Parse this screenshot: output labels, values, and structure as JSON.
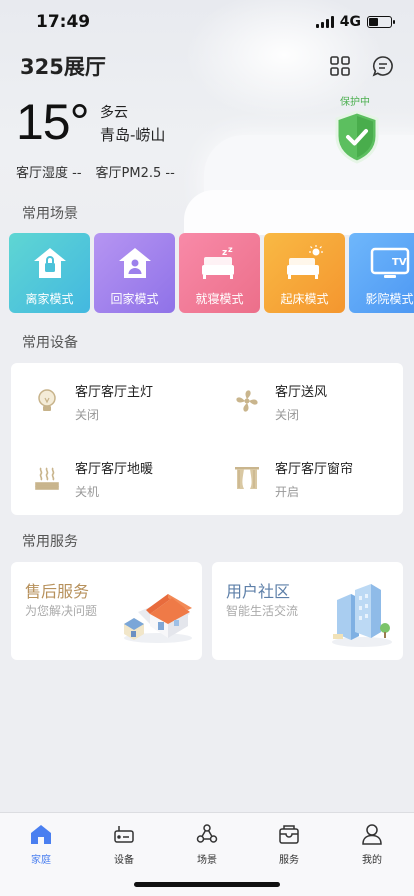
{
  "status_bar": {
    "time": "17:49",
    "network": "4G",
    "battery_level": 0.45
  },
  "header": {
    "home_name": "325展厅",
    "icons": [
      "grid-icon",
      "message-icon"
    ]
  },
  "weather": {
    "temperature": "15°",
    "condition": "多云",
    "location": "青岛-崂山",
    "humidity": "客厅湿度 --",
    "pm25": "客厅PM2.5 --"
  },
  "security": {
    "status": "保护中",
    "color": "#4caf50"
  },
  "scenes": {
    "title": "常用场景",
    "items": [
      {
        "label": "离家模式",
        "icon": "house-lock-icon",
        "color": "#43b8e0"
      },
      {
        "label": "回家模式",
        "icon": "house-person-icon",
        "color": "#8f72e8"
      },
      {
        "label": "就寝模式",
        "icon": "bed-sleep-icon",
        "color": "#ec6f8a"
      },
      {
        "label": "起床模式",
        "icon": "bed-sun-icon",
        "color": "#f4962f"
      },
      {
        "label": "影院模式",
        "icon": "tv-icon",
        "color": "#4a95f2"
      }
    ]
  },
  "devices": {
    "title": "常用设备",
    "items": [
      {
        "name": "客厅客厅主灯",
        "state": "关闭",
        "icon": "bulb-icon"
      },
      {
        "name": "客厅送风",
        "state": "关闭",
        "icon": "fan-icon"
      },
      {
        "name": "客厅客厅地暖",
        "state": "关机",
        "icon": "floor-heating-icon"
      },
      {
        "name": "客厅客厅窗帘",
        "state": "开启",
        "icon": "curtain-icon"
      }
    ]
  },
  "services": {
    "title": "常用服务",
    "items": [
      {
        "title": "售后服务",
        "subtitle": "为您解决问题",
        "color": "#b7915c",
        "icon": "house-illustration"
      },
      {
        "title": "用户社区",
        "subtitle": "智能生活交流",
        "color": "#5d7fa8",
        "icon": "buildings-illustration"
      }
    ]
  },
  "tabbar": {
    "active_color": "#4a7ff0",
    "items": [
      {
        "label": "家庭",
        "icon": "home-icon",
        "active": true
      },
      {
        "label": "设备",
        "icon": "router-icon",
        "active": false
      },
      {
        "label": "场景",
        "icon": "nodes-icon",
        "active": false
      },
      {
        "label": "服务",
        "icon": "service-box-icon",
        "active": false
      },
      {
        "label": "我的",
        "icon": "user-icon",
        "active": false
      }
    ]
  }
}
